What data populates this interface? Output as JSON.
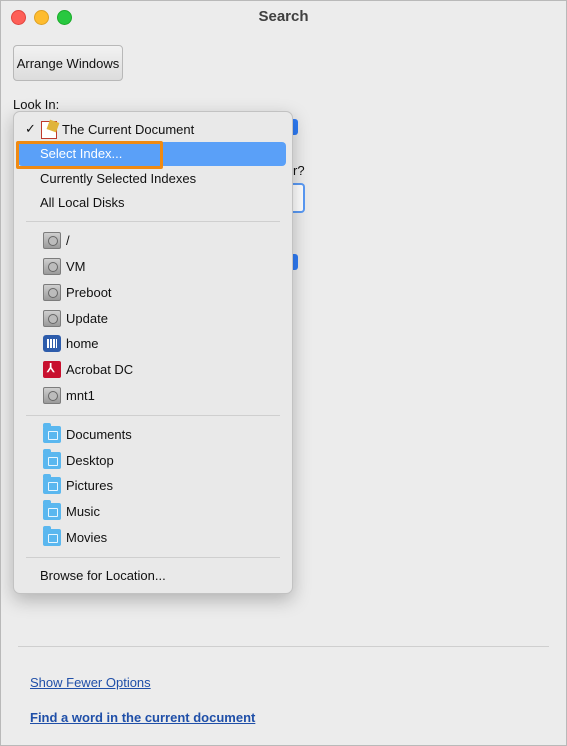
{
  "window": {
    "title": "Search"
  },
  "toolbar": {
    "arrange_label": "Arrange Windows"
  },
  "form": {
    "look_in_label": "Look In:",
    "frag_question": "r?"
  },
  "menu": {
    "current_document": "The Current Document",
    "select_index": "Select Index...",
    "currently_selected_indexes": "Currently Selected Indexes",
    "all_local_disks": "All Local Disks",
    "volumes": [
      {
        "label": "/",
        "icon": "disk-icon"
      },
      {
        "label": "VM",
        "icon": "disk-icon"
      },
      {
        "label": "Preboot",
        "icon": "disk-icon"
      },
      {
        "label": "Update",
        "icon": "disk-icon"
      },
      {
        "label": "home",
        "icon": "home-icon"
      },
      {
        "label": "Acrobat DC",
        "icon": "acrobat-icon"
      },
      {
        "label": "mnt1",
        "icon": "disk-icon"
      }
    ],
    "folders": [
      {
        "label": "Documents",
        "icon": "folder-icon"
      },
      {
        "label": "Desktop",
        "icon": "folder-icon"
      },
      {
        "label": "Pictures",
        "icon": "folder-icon"
      },
      {
        "label": "Music",
        "icon": "folder-icon"
      },
      {
        "label": "Movies",
        "icon": "folder-icon"
      }
    ],
    "browse": "Browse for Location...",
    "highlight_color": "#5aa0f8"
  },
  "footer": {
    "show_fewer": "Show Fewer Options",
    "find_word": "Find a word in the current document"
  },
  "colors": {
    "callout": "#f08a12",
    "link": "#1f4fa8"
  }
}
